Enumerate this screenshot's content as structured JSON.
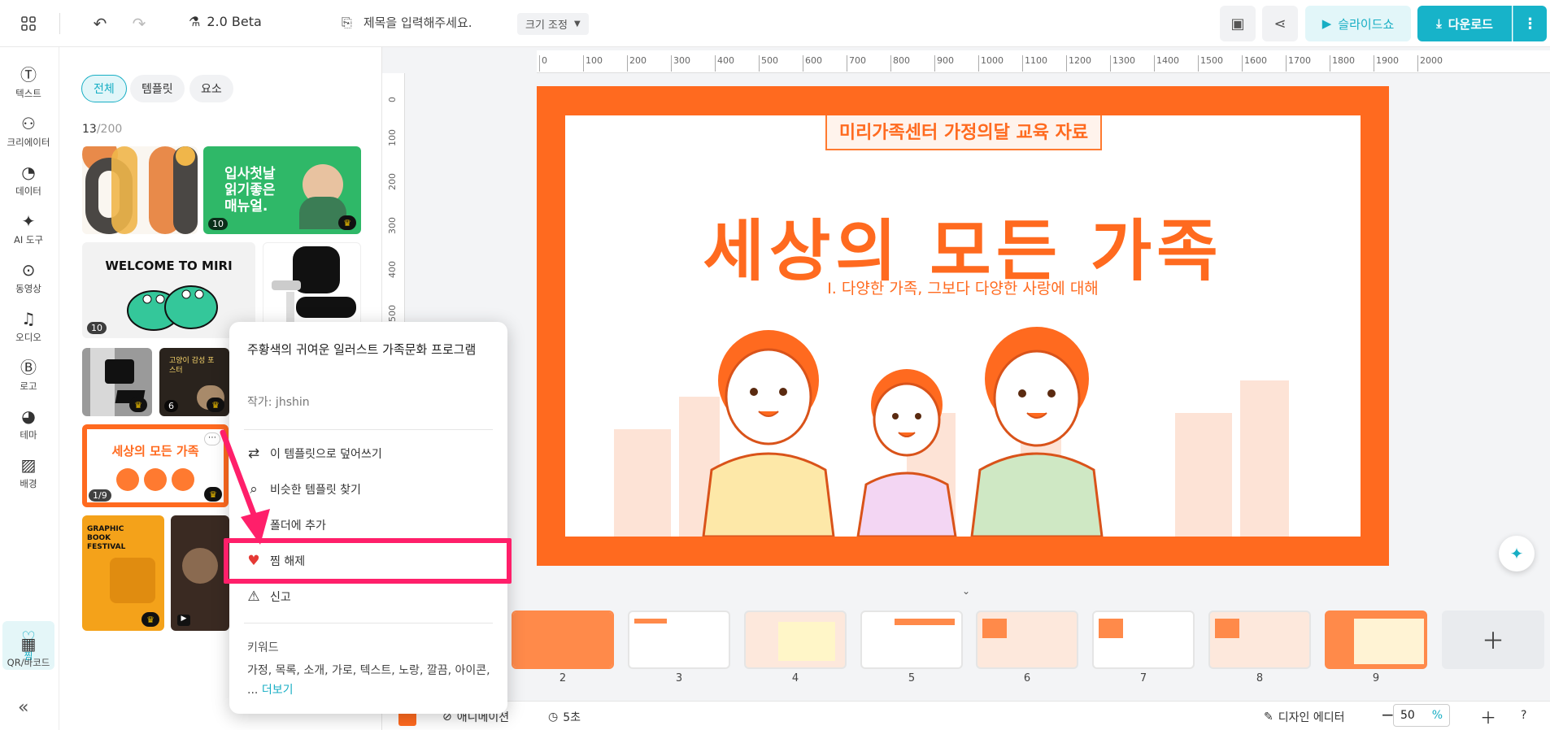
{
  "topbar": {
    "version": "2.0 Beta",
    "doc_title_placeholder": "제목을 입력해주세요.",
    "resize_label": "크기 조정",
    "slideshow_label": "슬라이드쇼",
    "download_label": "다운로드"
  },
  "rail": {
    "items": [
      {
        "label": "텍스트",
        "icon": "text-icon"
      },
      {
        "label": "크리에이터",
        "icon": "creator-icon"
      },
      {
        "label": "데이터",
        "icon": "chart-icon"
      },
      {
        "label": "AI 도구",
        "icon": "sparkle-icon"
      },
      {
        "label": "동영상",
        "icon": "play-icon"
      },
      {
        "label": "오디오",
        "icon": "music-icon"
      },
      {
        "label": "로고",
        "icon": "logo-icon"
      },
      {
        "label": "테마",
        "icon": "palette-icon"
      },
      {
        "label": "배경",
        "icon": "background-icon"
      },
      {
        "label": "찜",
        "icon": "heart-icon"
      },
      {
        "label": "QR/바코드",
        "icon": "qr-icon"
      }
    ]
  },
  "panel": {
    "tabs": [
      "전체",
      "템플릿",
      "요소"
    ],
    "count_current": "13",
    "count_total": "/200",
    "thumbs": {
      "t2_title": "입사첫날 읽기좋은 매뉴얼.",
      "t2_badge": "10",
      "t3_title": "WELCOME TO MIRI",
      "t3_badge": "10",
      "t6_badge": "6",
      "t6_title": "고양이 감성 포스터",
      "t7_title": "세상의 모든 가족",
      "t7_badge": "1/9",
      "t8_title": "GRAPHIC BOOK FESTIVAL"
    }
  },
  "ruler": {
    "h": [
      "0",
      "100",
      "200",
      "300",
      "400",
      "500",
      "600",
      "700",
      "800",
      "900",
      "1000",
      "1100",
      "1200",
      "1300",
      "1400",
      "1500",
      "1600",
      "1700",
      "1800",
      "1900",
      "2000"
    ],
    "v": [
      "0",
      "100",
      "200",
      "300",
      "400",
      "500"
    ]
  },
  "slide": {
    "banner": "미리가족센터 가정의달 교육 자료",
    "title": "세상의 모든 가족",
    "subtitle": "I. 다양한 가족, 그보다 다양한 사랑에 대해"
  },
  "thumbnails": [
    "2",
    "3",
    "4",
    "5",
    "6",
    "7",
    "8",
    "9"
  ],
  "bottom": {
    "animation_label": "애니메이션",
    "duration_label": "5초",
    "design_editor_label": "디자인 에디터",
    "zoom_value": "50",
    "zoom_unit": "%"
  },
  "context_menu": {
    "title": "주황색의 귀여운 일러스트 가족문화 프로그램",
    "author": "작가: jhshin",
    "items": [
      {
        "label": "이 템플릿으로 덮어쓰기",
        "icon": "swap-icon"
      },
      {
        "label": "비슷한 템플릿 찾기",
        "icon": "search-icon"
      },
      {
        "label": "폴더에 추가",
        "icon": "folder-icon"
      },
      {
        "label": "찜 해제",
        "icon": "heart-filled-icon"
      },
      {
        "label": "신고",
        "icon": "warning-icon"
      }
    ],
    "keyword_header": "키워드",
    "keywords": "가정, 목록, 소개, 가로, 텍스트, 노랑, 깔끔, 아이콘, ...",
    "more_label": "더보기"
  },
  "colors": {
    "accent": "#17b3c9",
    "slide_orange": "#ff6a1f",
    "highlight": "#ff1f6a"
  }
}
